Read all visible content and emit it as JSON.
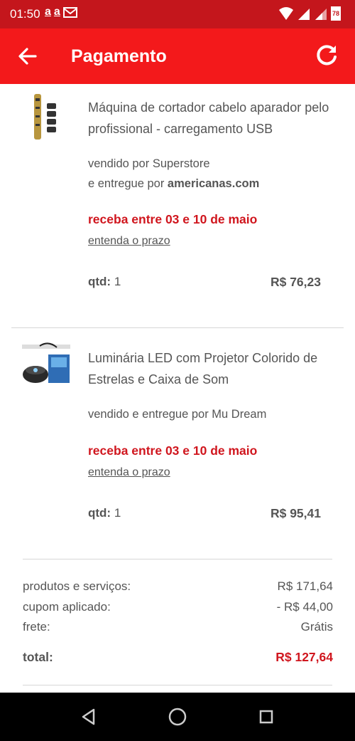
{
  "status_bar": {
    "time": "01:50",
    "notif_icons": [
      "a",
      "a"
    ],
    "battery": "78"
  },
  "app_bar": {
    "title": "Pagamento"
  },
  "products": [
    {
      "name": "Máquina de cortador cabelo aparador pelo profissional - carregamento USB",
      "seller_line1": "vendido por Superstore",
      "seller_line2_prefix": "e entregue por ",
      "seller_line2_brand": "americanas.com",
      "delivery": "receba entre 03 e 10 de maio",
      "prazo_link": "entenda o prazo",
      "qtd_label": "qtd:",
      "qtd_value": "1",
      "price": "R$ 76,23"
    },
    {
      "name": "Luminária LED com Projetor Colorido de Estrelas e Caixa de Som",
      "seller_line1": "vendido e entregue por Mu Dream",
      "delivery": "receba entre 03 e 10 de maio",
      "prazo_link": "entenda o prazo",
      "qtd_label": "qtd:",
      "qtd_value": "1",
      "price": "R$ 95,41"
    }
  ],
  "summary": {
    "produtos_label": "produtos e serviços:",
    "produtos_value": "R$ 171,64",
    "cupom_label": "cupom aplicado:",
    "cupom_value": "- R$ 44,00",
    "frete_label": "frete:",
    "frete_value": "Grátis",
    "total_label": "total:",
    "total_value": "R$ 127,64"
  },
  "colors": {
    "status_bar": "#c4161c",
    "app_bar": "#f3191b",
    "accent_red": "#d0161e"
  }
}
